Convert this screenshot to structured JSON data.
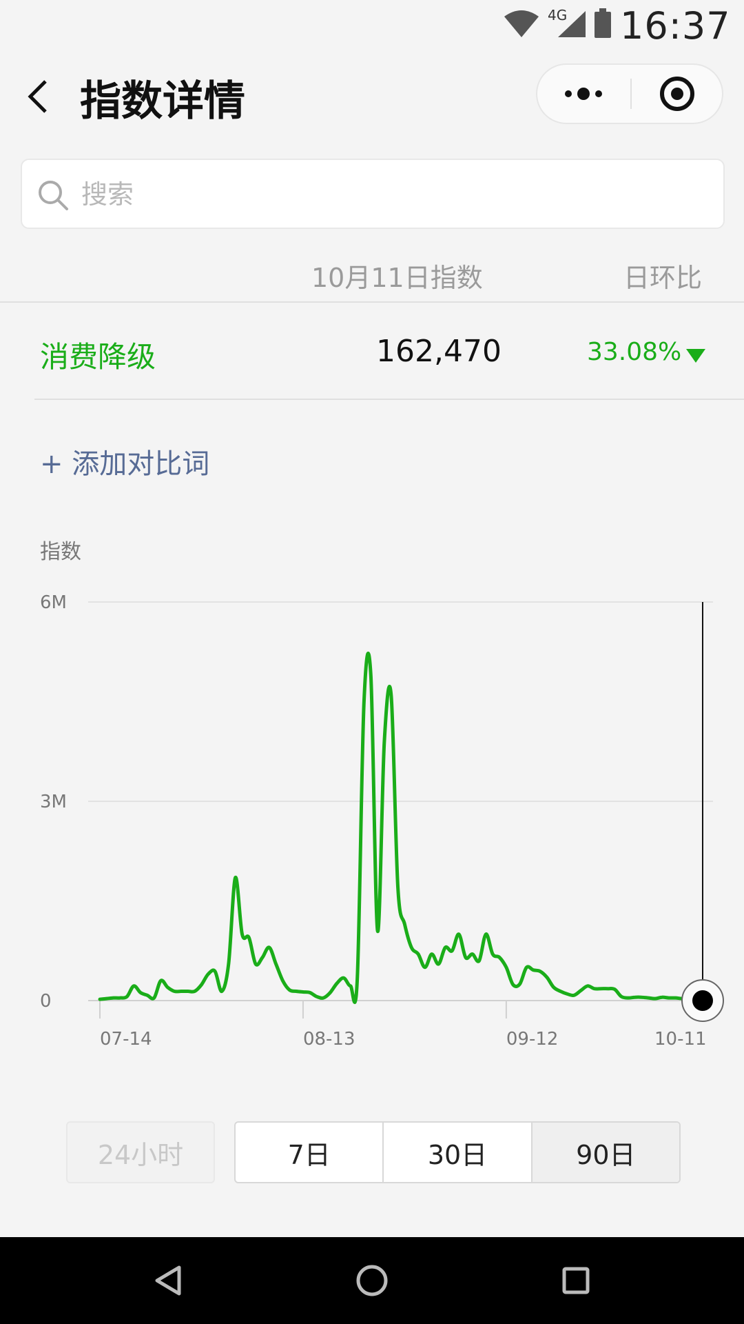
{
  "status_bar": {
    "time": "16:37",
    "network": "4G"
  },
  "header": {
    "title": "指数详情"
  },
  "search": {
    "placeholder": "搜索"
  },
  "table": {
    "col_date": "10月11日指数",
    "col_change": "日环比",
    "row": {
      "keyword": "消费降级",
      "value": "162,470",
      "change": "33.08%",
      "direction": "down"
    }
  },
  "add_compare": "+ 添加对比词",
  "colors": {
    "accent": "#1aad19",
    "link": "#576b95"
  },
  "chart_data": {
    "type": "line",
    "ylabel": "指数",
    "ylim": [
      0,
      6000000
    ],
    "yticks": [
      {
        "value": 0,
        "label": "0"
      },
      {
        "value": 3000000,
        "label": "3M"
      },
      {
        "value": 6000000,
        "label": "6M"
      }
    ],
    "xlim": [
      1,
      90
    ],
    "xticks": [
      {
        "day": 1,
        "label": "07-14"
      },
      {
        "day": 31,
        "label": "08-13"
      },
      {
        "day": 61,
        "label": "09-12"
      },
      {
        "day": 90,
        "label": "10-11"
      }
    ],
    "series": [
      {
        "values": [
          20000,
          30000,
          40000,
          40000,
          60000,
          220000,
          120000,
          80000,
          40000,
          300000,
          200000,
          140000,
          140000,
          140000,
          140000,
          240000,
          400000,
          440000,
          140000,
          550000,
          1850000,
          1000000,
          950000,
          550000,
          650000,
          800000,
          550000,
          300000,
          160000,
          140000,
          130000,
          120000,
          60000,
          40000,
          120000,
          260000,
          340000,
          220000,
          320000,
          4500000,
          4900000,
          1050000,
          3900000,
          4600000,
          1700000,
          1150000,
          800000,
          700000,
          500000,
          700000,
          550000,
          800000,
          750000,
          1000000,
          650000,
          700000,
          600000,
          1000000,
          700000,
          650000,
          500000,
          240000,
          250000,
          500000,
          460000,
          440000,
          350000,
          200000,
          140000,
          100000,
          80000,
          150000,
          220000,
          180000,
          180000,
          180000,
          170000,
          60000,
          40000,
          50000,
          50000,
          40000,
          30000,
          50000,
          40000,
          40000,
          30000,
          40000,
          50000,
          162470
        ]
      }
    ],
    "cursor_day": 90
  },
  "periods": {
    "h24": "24小时",
    "d7": "7日",
    "d30": "30日",
    "d90": "90日",
    "active": "d90"
  }
}
